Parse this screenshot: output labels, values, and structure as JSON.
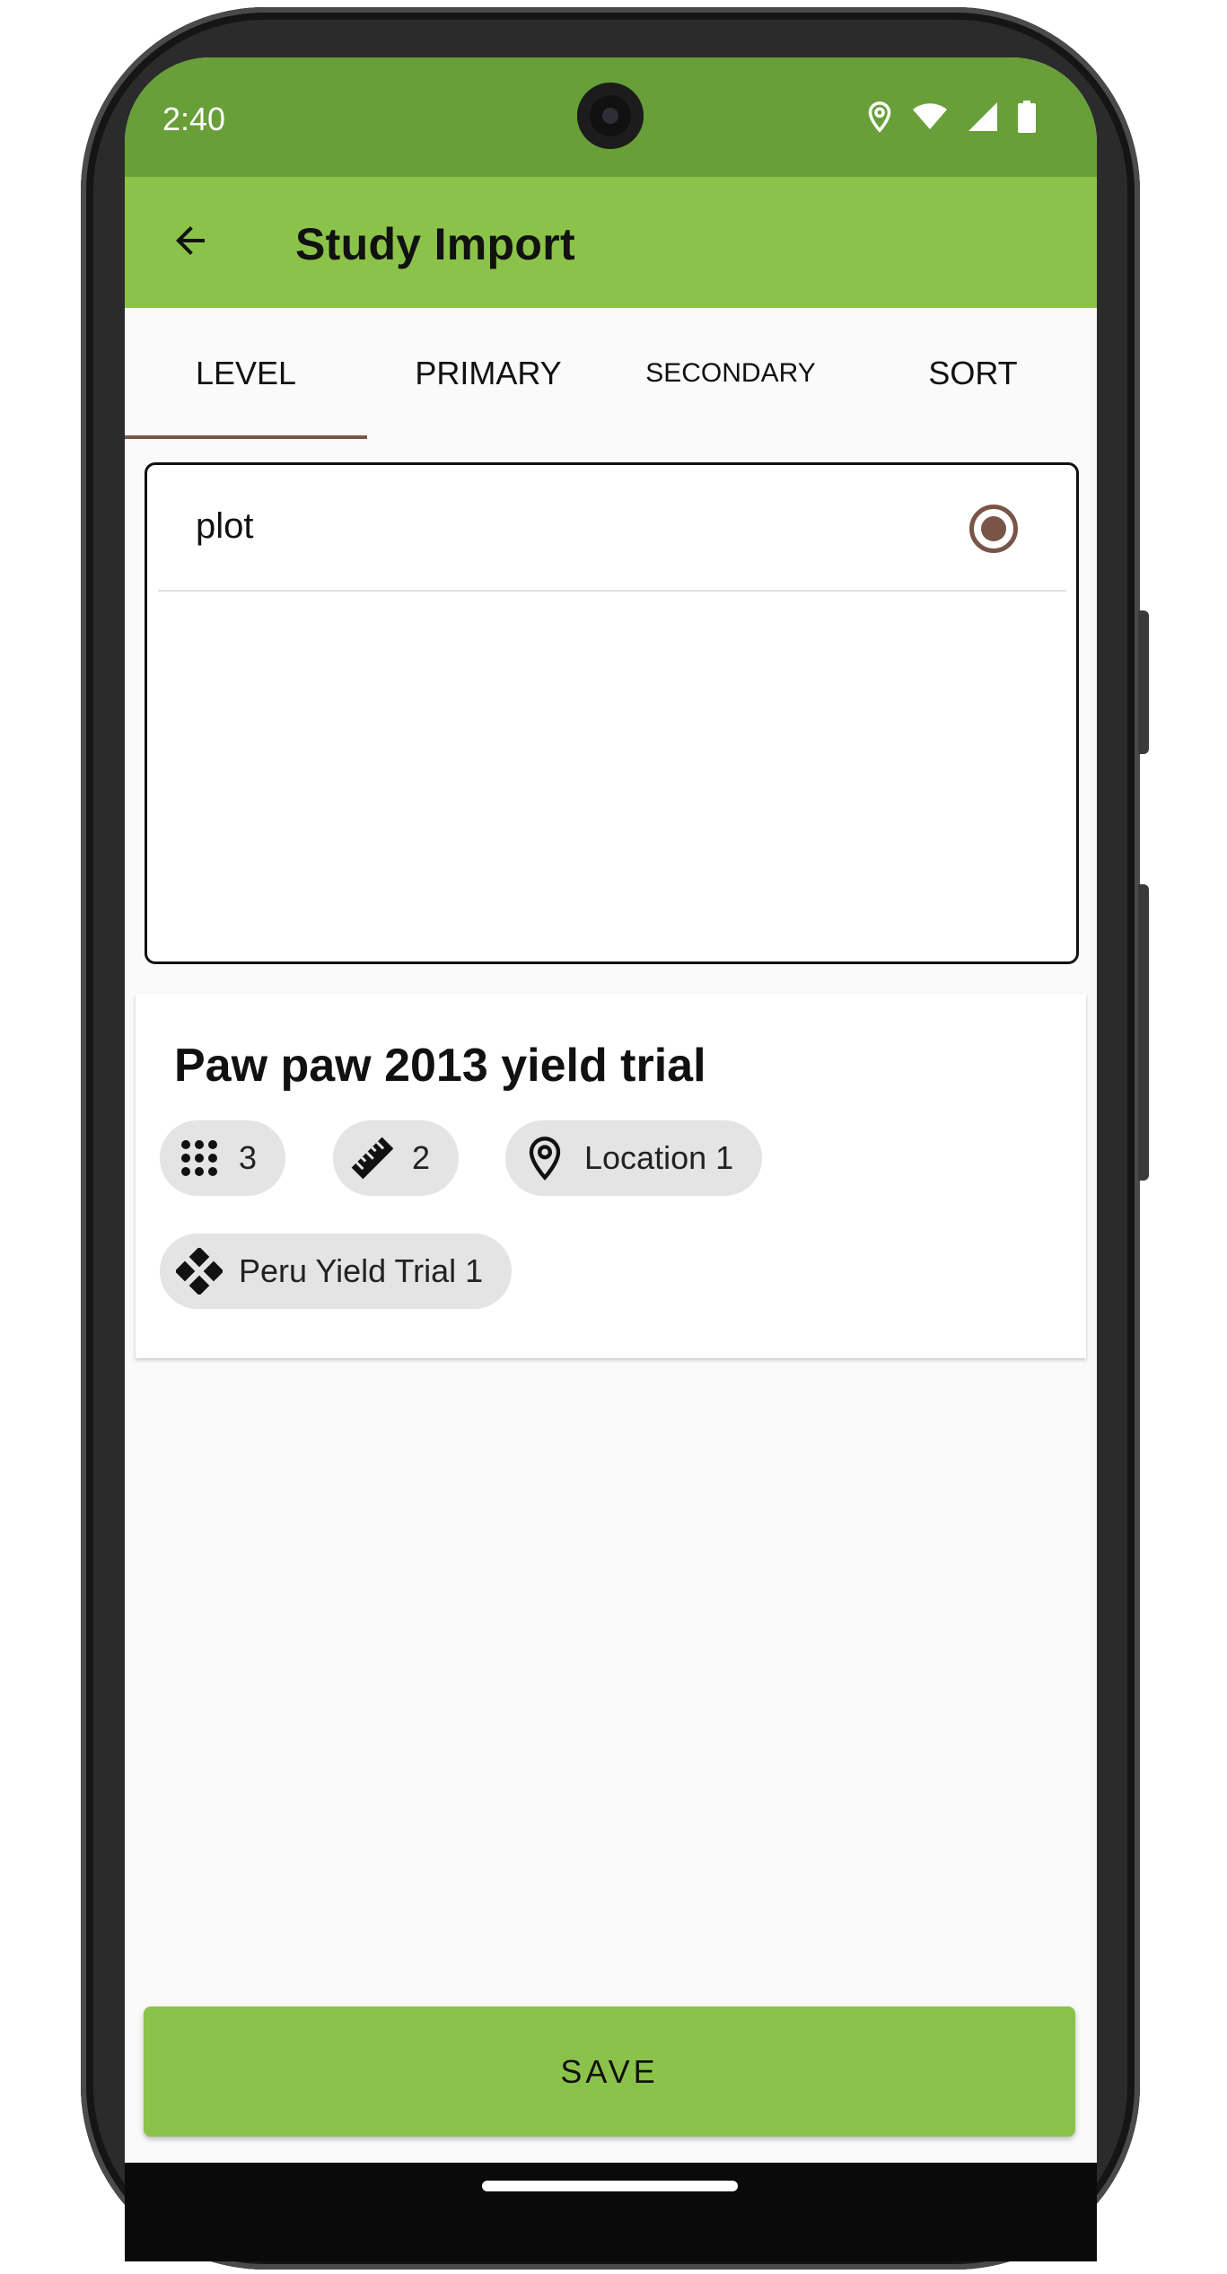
{
  "status_bar": {
    "time": "2:40",
    "icons": [
      "location-icon",
      "wifi-icon",
      "signal-icon",
      "battery-icon"
    ]
  },
  "app_bar": {
    "title": "Study Import",
    "back_icon": "arrow-back-icon"
  },
  "tabs": [
    {
      "label": "LEVEL",
      "selected": true
    },
    {
      "label": "PRIMARY",
      "selected": false
    },
    {
      "label": "SECONDARY",
      "selected": false
    },
    {
      "label": "SORT",
      "selected": false
    }
  ],
  "level_list": {
    "items": [
      {
        "label": "plot",
        "selected": true
      }
    ]
  },
  "study_card": {
    "title": "Paw paw 2013 yield trial",
    "chips": [
      {
        "icon": "grid-dots-icon",
        "label": "3"
      },
      {
        "icon": "ruler-icon",
        "label": "2"
      },
      {
        "icon": "location-pin-icon",
        "label": "Location 1"
      },
      {
        "icon": "diamond-cluster-icon",
        "label": "Peru Yield Trial 1"
      }
    ]
  },
  "save_button": {
    "label": "SAVE"
  },
  "colors": {
    "status_bar": "#689f38",
    "app_bar": "#8bc34a",
    "accent": "#795548",
    "chip_bg": "#e4e4e4"
  }
}
